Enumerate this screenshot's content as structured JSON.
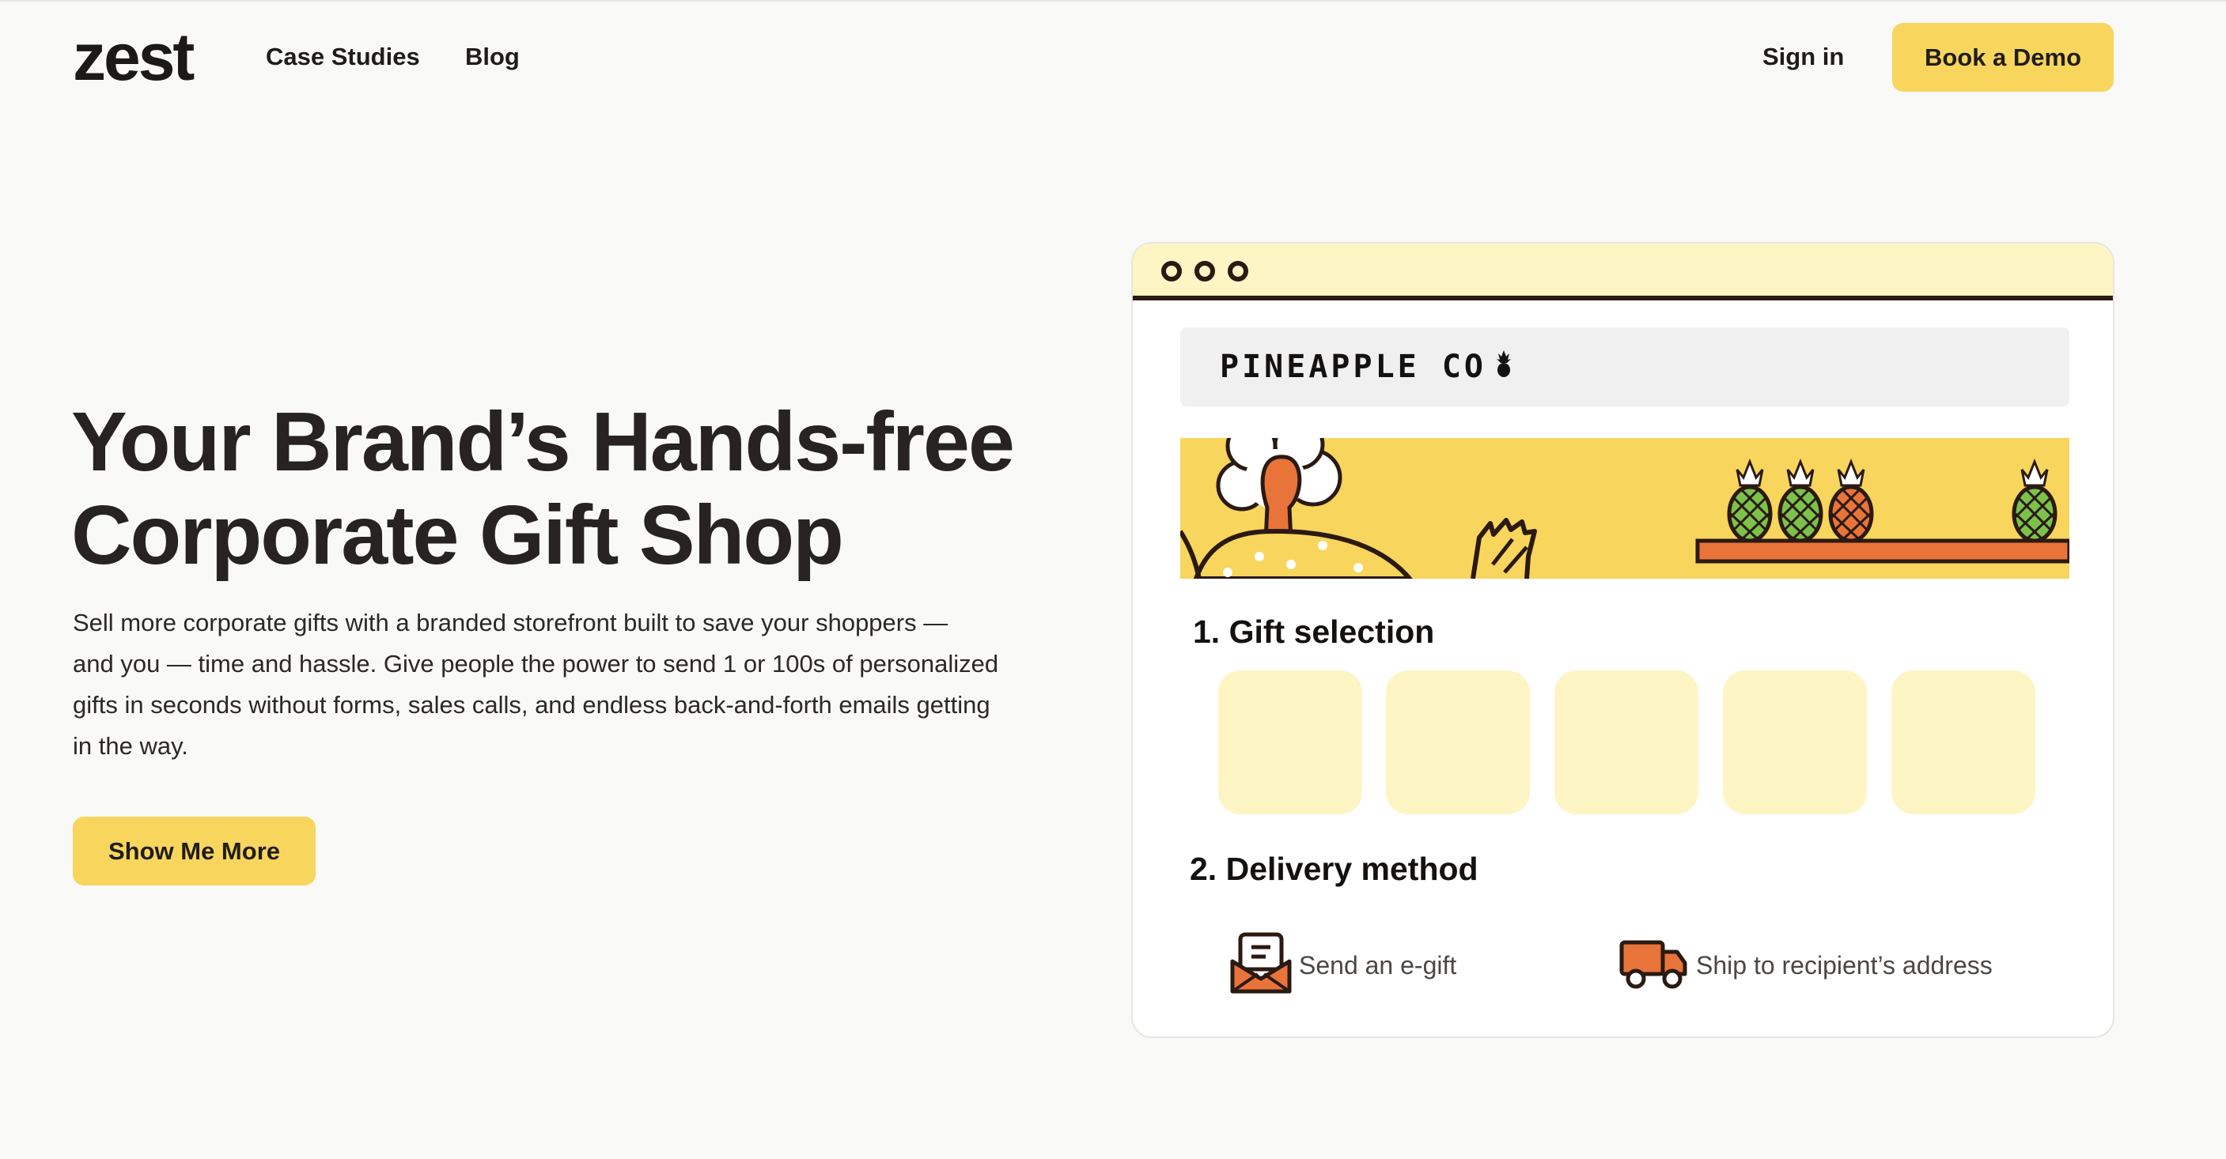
{
  "nav": {
    "logo": "zest",
    "links": [
      "Case Studies",
      "Blog"
    ],
    "sign_in": "Sign in",
    "cta": "Book a Demo"
  },
  "hero": {
    "title_line1": "Your Brand’s Hands-free",
    "title_line2": "Corporate Gift Shop",
    "body_lines": [
      "Sell more corporate gifts with a branded storefront built to save your shoppers —",
      "and you — time and hassle. Give people the power to send 1 or 100s of personalized",
      "gifts in seconds without forms, sales calls, and endless back-and-forth emails getting",
      "in the way."
    ],
    "cta": "Show Me More"
  },
  "mockup": {
    "store_name": "PINEAPPLE CO",
    "section1_title": "1. Gift selection",
    "section2_title": "2. Delivery method",
    "delivery_options": [
      {
        "label": "Send an e-gift",
        "icon": "envelope-icon"
      },
      {
        "label": "Ship to recipient’s address",
        "icon": "truck-icon"
      }
    ],
    "colors": {
      "brand_yellow": "#f8d55c",
      "pale_yellow": "#fdf5c4",
      "accent_orange": "#e8743a",
      "accent_green": "#7cc24a",
      "ink": "#2a1a12"
    }
  }
}
